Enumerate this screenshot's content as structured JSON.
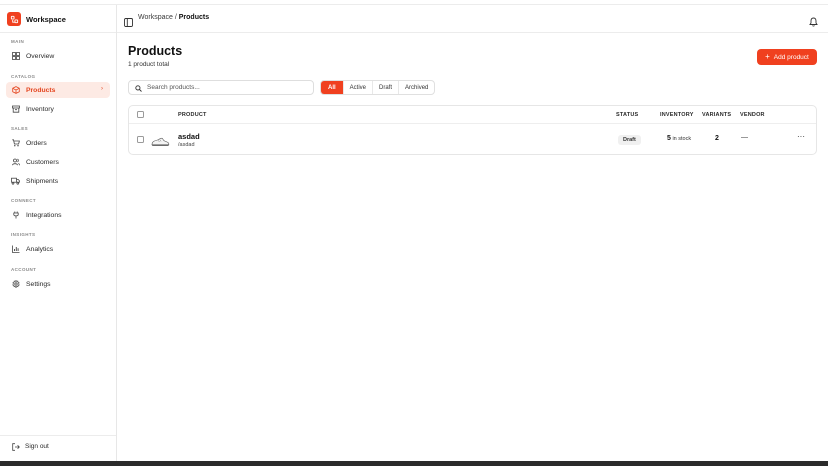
{
  "brand": {
    "name": "Workspace",
    "logo_icon": "workspace-logo-icon",
    "accent": "#f0401f"
  },
  "sidebar": {
    "sections": [
      {
        "label": "MAIN",
        "items": [
          {
            "label": "Overview",
            "icon": "grid-icon"
          }
        ]
      },
      {
        "label": "CATALOG",
        "items": [
          {
            "label": "Products",
            "icon": "package-icon",
            "active": true
          },
          {
            "label": "Inventory",
            "icon": "archive-icon"
          }
        ]
      },
      {
        "label": "SALES",
        "items": [
          {
            "label": "Orders",
            "icon": "cart-icon"
          },
          {
            "label": "Customers",
            "icon": "users-icon"
          },
          {
            "label": "Shipments",
            "icon": "truck-icon"
          }
        ]
      },
      {
        "label": "CONNECT",
        "items": [
          {
            "label": "Integrations",
            "icon": "plug-icon"
          }
        ]
      },
      {
        "label": "INSIGHTS",
        "items": [
          {
            "label": "Analytics",
            "icon": "bar-chart-icon"
          }
        ]
      },
      {
        "label": "ACCOUNT",
        "items": [
          {
            "label": "Settings",
            "icon": "gear-icon"
          }
        ]
      }
    ],
    "signout": "Sign out"
  },
  "header": {
    "breadcrumb_root": "Workspace",
    "breadcrumb_sep": "/",
    "breadcrumb_current": "Products"
  },
  "main": {
    "title": "Products",
    "subtitle": "1 product total",
    "add_button": "Add product",
    "search_placeholder": "Search products...",
    "filters": [
      {
        "label": "All",
        "active": true
      },
      {
        "label": "Active"
      },
      {
        "label": "Draft"
      },
      {
        "label": "Archived"
      }
    ],
    "table": {
      "columns": {
        "product": "PRODUCT",
        "status": "STATUS",
        "inventory": "INVENTORY",
        "variants": "VARIANTS",
        "vendor": "VENDOR"
      },
      "rows": [
        {
          "name": "asdad",
          "slug": "/asdad",
          "status": "Draft",
          "stock": "5",
          "stock_suffix": "in stock",
          "variants": "2",
          "vendor": "—",
          "actions": "···"
        }
      ]
    }
  }
}
